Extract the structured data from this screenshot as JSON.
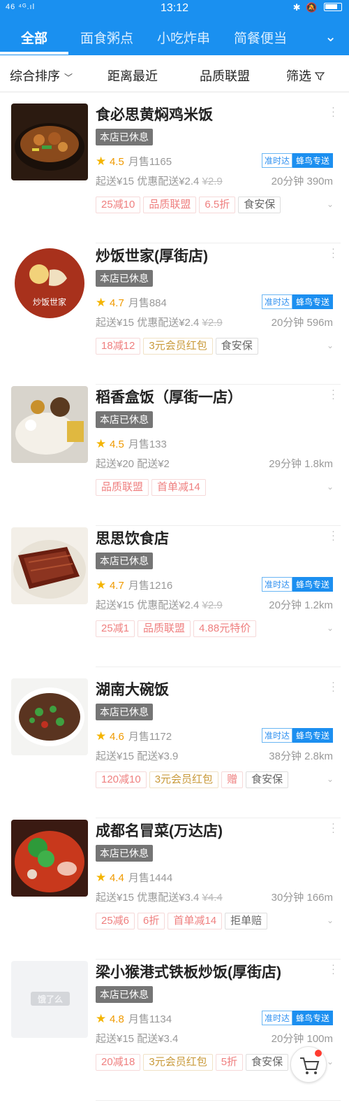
{
  "status_bar": {
    "left": "46 ⁴ᴳ.ıl",
    "time": "13:12",
    "right_icons": [
      "bluetooth-icon",
      "bell-off-icon",
      "battery-icon"
    ]
  },
  "tabs": [
    {
      "label": "全部",
      "active": true
    },
    {
      "label": "面食粥点",
      "active": false
    },
    {
      "label": "小吃炸串",
      "active": false
    },
    {
      "label": "简餐便当",
      "active": false
    }
  ],
  "filters": {
    "sort": "综合排序",
    "distance": "距离最近",
    "quality": "品质联盟",
    "filter": "筛选"
  },
  "shops": [
    {
      "name": "食必思黄焖鸡米饭",
      "status": "本店已休息",
      "rating": "4.5",
      "monthly_sales": "月售1165",
      "badges": [
        "准时达",
        "蜂鸟专送"
      ],
      "delivery": "起送¥15 优惠配送¥2.4",
      "delivery_old": "¥2.9",
      "time_dist": "20分钟 390m",
      "promos": [
        {
          "text": "25减10",
          "style": "red"
        },
        {
          "text": "品质联盟",
          "style": "red"
        },
        {
          "text": "6.5折",
          "style": "red"
        },
        {
          "text": "食安保",
          "style": "gray"
        }
      ]
    },
    {
      "name": "炒饭世家(厚街店)",
      "status": "本店已休息",
      "rating": "4.7",
      "monthly_sales": "月售884",
      "badges": [
        "准时达",
        "蜂鸟专送"
      ],
      "delivery": "起送¥15 优惠配送¥2.4",
      "delivery_old": "¥2.9",
      "time_dist": "20分钟 596m",
      "logo_text": "炒饭世家",
      "promos": [
        {
          "text": "18减12",
          "style": "red"
        },
        {
          "text": "3元会员红包",
          "style": "gold"
        },
        {
          "text": "食安保",
          "style": "gray"
        }
      ]
    },
    {
      "name": "稻香盒饭（厚街一店）",
      "status": "本店已休息",
      "rating": "4.5",
      "monthly_sales": "月售133",
      "badges": [],
      "delivery": "起送¥20 配送¥2",
      "delivery_old": "",
      "time_dist": "29分钟 1.8km",
      "promos": [
        {
          "text": "品质联盟",
          "style": "red"
        },
        {
          "text": "首单减14",
          "style": "red"
        }
      ]
    },
    {
      "name": "思思饮食店",
      "status": "本店已休息",
      "rating": "4.7",
      "monthly_sales": "月售1216",
      "badges": [
        "准时达",
        "蜂鸟专送"
      ],
      "delivery": "起送¥15 优惠配送¥2.4",
      "delivery_old": "¥2.9",
      "time_dist": "20分钟 1.2km",
      "promos": [
        {
          "text": "25减1",
          "style": "red"
        },
        {
          "text": "品质联盟",
          "style": "red"
        },
        {
          "text": "4.88元特价",
          "style": "red"
        }
      ]
    },
    {
      "name": "湖南大碗饭",
      "status": "本店已休息",
      "rating": "4.6",
      "monthly_sales": "月售1172",
      "badges": [
        "准时达",
        "蜂鸟专送"
      ],
      "delivery": "起送¥15 配送¥3.9",
      "delivery_old": "",
      "time_dist": "38分钟 2.8km",
      "promos": [
        {
          "text": "120减10",
          "style": "red"
        },
        {
          "text": "3元会员红包",
          "style": "gold"
        },
        {
          "text": "赠",
          "style": "red"
        },
        {
          "text": "食安保",
          "style": "gray"
        }
      ]
    },
    {
      "name": "成都名冒菜(万达店)",
      "status": "本店已休息",
      "rating": "4.4",
      "monthly_sales": "月售1444",
      "badges": [],
      "delivery": "起送¥15 优惠配送¥3.4",
      "delivery_old": "¥4.4",
      "time_dist": "30分钟 166m",
      "promos": [
        {
          "text": "25减6",
          "style": "red"
        },
        {
          "text": "6折",
          "style": "red"
        },
        {
          "text": "首单减14",
          "style": "red"
        },
        {
          "text": "拒单赔",
          "style": "gray"
        }
      ]
    },
    {
      "name": "梁小猴港式铁板炒饭(厚街店)",
      "status": "本店已休息",
      "rating": "4.8",
      "monthly_sales": "月售1134",
      "badges": [
        "准时达",
        "蜂鸟专送"
      ],
      "delivery": "起送¥15 配送¥3.4",
      "delivery_old": "",
      "time_dist": "20分钟 100m",
      "logo_text": "饿了么",
      "promos": [
        {
          "text": "20减18",
          "style": "red"
        },
        {
          "text": "3元会员红包",
          "style": "gold"
        },
        {
          "text": "5折",
          "style": "red"
        },
        {
          "text": "食安保",
          "style": "gray"
        }
      ]
    }
  ],
  "colors": {
    "brand_blue": "#1a90f0",
    "star": "#f4b400",
    "promo_red": "#ef7f7f",
    "closed_badge": "#757575"
  }
}
